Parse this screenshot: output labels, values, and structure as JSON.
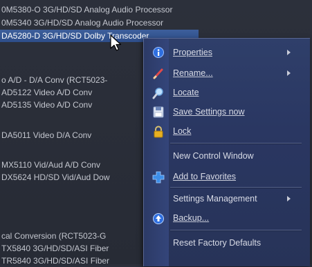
{
  "tree": {
    "items": [
      {
        "label": "0M5380-O 3G/HD/SD Analog Audio Processor"
      },
      {
        "label": "0M5340 3G/HD/SD Analog Audio Processor"
      },
      {
        "label": "DA5280-D 3G/HD/SD Dolby Transcoder"
      },
      {
        "label": "o A/D - D/A Conv (RCT5023-"
      },
      {
        "label": "AD5122 Video A/D Conv"
      },
      {
        "label": "AD5135 Video A/D Conv"
      },
      {
        "label": "DA5011 Video D/A Conv"
      },
      {
        "label": "MX5110 Vid/Aud A/D Conv"
      },
      {
        "label": "DX5624 HD/SD Vid/Aud Dow"
      },
      {
        "label": "cal Conversion (RCT5023-G"
      },
      {
        "label": "TX5840 3G/HD/SD/ASI Fiber"
      },
      {
        "label": "TR5840 3G/HD/SD/ASI Fiber"
      }
    ]
  },
  "context_menu": {
    "items": [
      {
        "label": "Properties",
        "icon": "info-icon"
      },
      {
        "label": "Rename...",
        "icon": "pencil-icon"
      },
      {
        "label": "Locate",
        "icon": "magnifier-icon"
      },
      {
        "label": "Save Settings now",
        "icon": "floppy-disk-icon"
      },
      {
        "label": "Lock",
        "icon": "padlock-icon"
      },
      {
        "label": "New Control Window"
      },
      {
        "label": "Add to Favorites",
        "icon": "plus-icon"
      },
      {
        "label": "Settings Management"
      },
      {
        "label": "Backup...",
        "icon": "backup-icon"
      },
      {
        "label": "Reset Factory Defaults"
      }
    ]
  },
  "colors": {
    "tree_background": "#2b2f3a",
    "selection": "#3d5f9c",
    "menu_background": "#2a3762",
    "info_icon": "#2f6fe0",
    "lock_icon": "#e8b020",
    "plus_icon": "#3d8ee8"
  }
}
